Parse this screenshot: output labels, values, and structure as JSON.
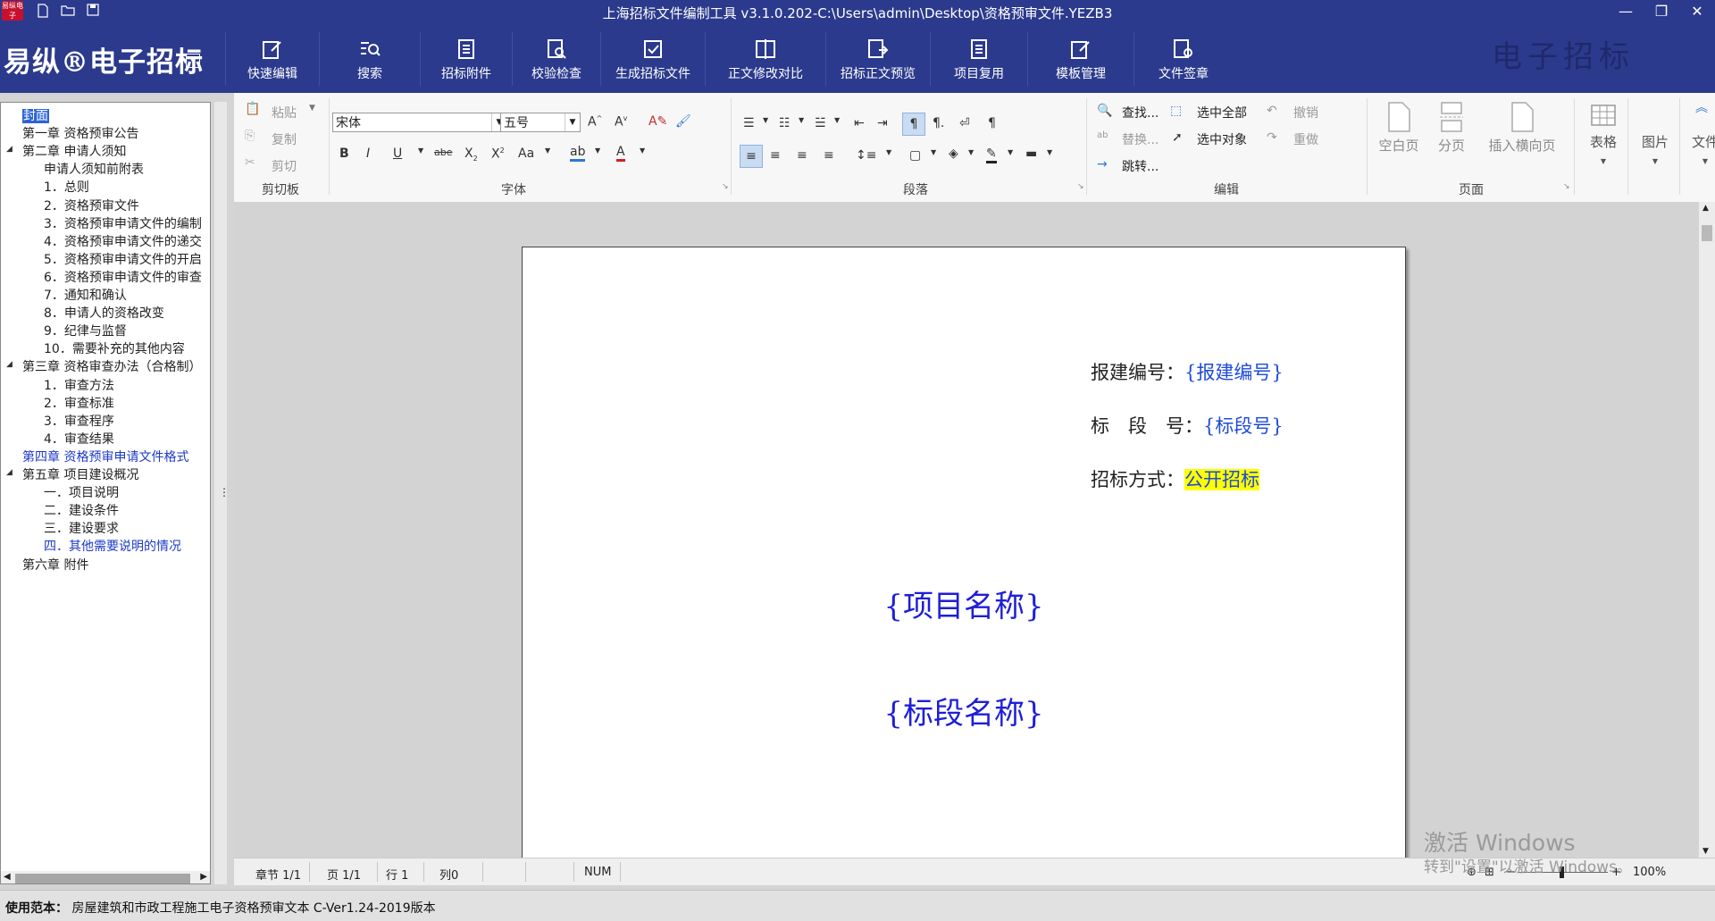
{
  "titlebar": {
    "logo_text": "易纵电子",
    "title": "上海招标文件编制工具 v3.1.0.202-C:\\Users\\admin\\Desktop\\资格预审文件.YEZB3",
    "quick_access": [
      "new-file-icon",
      "open-folder-icon",
      "save-icon"
    ],
    "controls": [
      "minimize-icon",
      "restore-icon",
      "close-icon"
    ]
  },
  "brand": {
    "name": "易纵®电子招标",
    "watermark": "电子招标"
  },
  "main_toolbar": [
    {
      "label": "快速编辑",
      "icon": "quick-edit-icon"
    },
    {
      "label": "搜索",
      "icon": "search-icon"
    },
    {
      "label": "招标附件",
      "icon": "attachment-icon"
    },
    {
      "label": "校验检查",
      "icon": "check-icon"
    },
    {
      "label": "生成招标文件",
      "icon": "generate-file-icon"
    },
    {
      "label": "正文修改对比",
      "icon": "compare-icon"
    },
    {
      "label": "招标正文预览",
      "icon": "preview-icon"
    },
    {
      "label": "项目复用",
      "icon": "reuse-icon"
    },
    {
      "label": "模板管理",
      "icon": "template-icon"
    },
    {
      "label": "文件签章",
      "icon": "sign-icon"
    }
  ],
  "ribbon": {
    "clipboard": {
      "paste": "粘贴",
      "copy": "复制",
      "cut": "剪切",
      "group": "剪切板"
    },
    "font": {
      "family": "宋体",
      "size": "五号",
      "group": "字体"
    },
    "paragraph": {
      "group": "段落"
    },
    "edit": {
      "find": "查找...",
      "replace": "替换...",
      "goto": "跳转...",
      "select_all": "选中全部",
      "select_object": "选中对象",
      "undo": "撤销",
      "redo": "重做",
      "group": "编辑"
    },
    "page": {
      "blank": "空白页",
      "break": "分页",
      "landscape": "插入横向页",
      "group": "页面"
    },
    "table": "表格",
    "picture": "图片",
    "file": "文件"
  },
  "nav": {
    "items": [
      {
        "label": "封面",
        "level": 0,
        "selected": true
      },
      {
        "label": "第一章 资格预审公告",
        "level": 0
      },
      {
        "label": "第二章 申请人须知",
        "level": 0,
        "expanded": true
      },
      {
        "label": "申请人须知前附表",
        "level": 1
      },
      {
        "label": "1．总则",
        "level": 1
      },
      {
        "label": "2．资格预审文件",
        "level": 1
      },
      {
        "label": "3．资格预审申请文件的编制",
        "level": 1
      },
      {
        "label": "4．资格预审申请文件的递交",
        "level": 1
      },
      {
        "label": "5．资格预审申请文件的开启",
        "level": 1
      },
      {
        "label": "6．资格预审申请文件的审查",
        "level": 1
      },
      {
        "label": "7．通知和确认",
        "level": 1
      },
      {
        "label": "8．申请人的资格改变",
        "level": 1
      },
      {
        "label": "9．纪律与监督",
        "level": 1
      },
      {
        "label": "10．需要补充的其他内容",
        "level": 1
      },
      {
        "label": "第三章 资格审查办法（合格制）",
        "level": 0,
        "expanded": true
      },
      {
        "label": "1．审查方法",
        "level": 1
      },
      {
        "label": "2．审查标准",
        "level": 1
      },
      {
        "label": "3．审查程序",
        "level": 1
      },
      {
        "label": "4．审查结果",
        "level": 1
      },
      {
        "label": "第四章 资格预审申请文件格式",
        "level": 0,
        "blue": true
      },
      {
        "label": "第五章 项目建设概况",
        "level": 0,
        "expanded": true
      },
      {
        "label": "一．项目说明",
        "level": 1
      },
      {
        "label": "二．建设条件",
        "level": 1
      },
      {
        "label": "三．建设要求",
        "level": 1
      },
      {
        "label": "四．其他需要说明的情况",
        "level": 1,
        "blue": true
      },
      {
        "label": "第六章 附件",
        "level": 0
      }
    ]
  },
  "document": {
    "report_no_label": "报建编号：",
    "report_no_value": "{报建编号}",
    "section_no_label": "标　段　号：",
    "section_no_value": "{标段号}",
    "method_label": "招标方式：",
    "method_value": "公开招标",
    "project_name": "{项目名称}",
    "section_name": "{标段名称}"
  },
  "editor_status": {
    "section": "章节 1/1",
    "page": "页 1/1",
    "line": "行 1",
    "col": "列0",
    "num": "NUM",
    "zoom": "100%"
  },
  "watermark": {
    "line1": "激活 Windows",
    "line2": "转到\"设置\"以激活 Windows。"
  },
  "bottom": {
    "label": "使用范本：",
    "value": "房屋建筑和市政工程施工电子资格预审文本  C-Ver1.24-2019版本"
  }
}
